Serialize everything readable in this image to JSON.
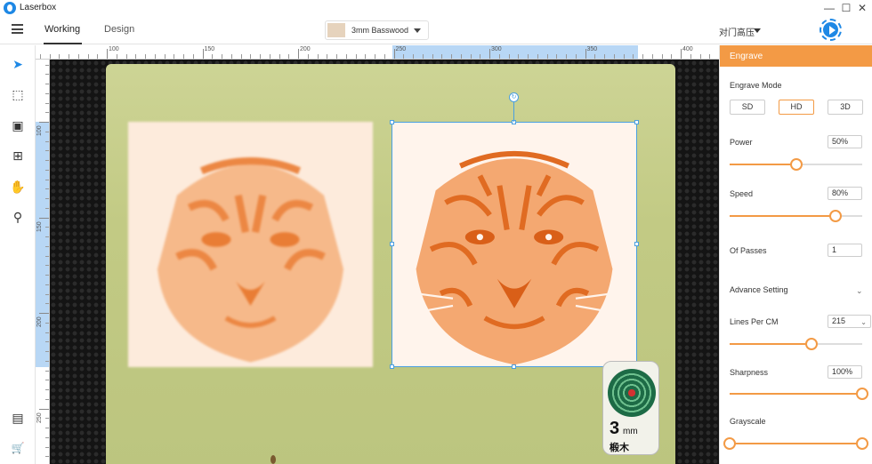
{
  "app": {
    "title": "Laserbox"
  },
  "window_controls": {
    "minimize": "—",
    "maximize": "☐",
    "close": "✕"
  },
  "header": {
    "tabs": [
      {
        "label": "Working",
        "active": true
      },
      {
        "label": "Design",
        "active": false
      }
    ],
    "material": "3mm Basswood",
    "device": "对门高压"
  },
  "tools": [
    {
      "name": "select-tool-icon",
      "glyph": "➤"
    },
    {
      "name": "node-edit-icon",
      "glyph": "⬚"
    },
    {
      "name": "image-icon",
      "glyph": "▣"
    },
    {
      "name": "shape-icon",
      "glyph": "⊞"
    },
    {
      "name": "hand-icon",
      "glyph": "✋"
    },
    {
      "name": "zoom-icon",
      "glyph": "⚲"
    },
    {
      "name": "layers-icon",
      "glyph": "▤"
    },
    {
      "name": "cart-icon",
      "glyph": "🛒"
    }
  ],
  "rulers": {
    "top_labels": [
      "100",
      "150",
      "200",
      "250",
      "300",
      "350",
      "400"
    ],
    "left_labels": [
      "100",
      "150",
      "200",
      "250"
    ]
  },
  "material_tag": {
    "thickness": "3",
    "unit": "mm",
    "name": "椴木"
  },
  "panel": {
    "title": "Engrave",
    "engrave_mode": {
      "label": "Engrave Mode",
      "options": [
        "SD",
        "HD",
        "3D"
      ],
      "selected": "HD"
    },
    "power": {
      "label": "Power",
      "value": "50%",
      "level": 0.5
    },
    "speed": {
      "label": "Speed",
      "value": "80%",
      "level": 0.8
    },
    "passes": {
      "label": "Of Passes",
      "value": "1"
    },
    "advance": {
      "label": "Advance Setting",
      "caret": "⌄"
    },
    "lines_per_cm": {
      "label": "Lines Per CM",
      "value": "215",
      "level": 0.62
    },
    "sharpness": {
      "label": "Sharpness",
      "value": "100%",
      "level": 1.0
    },
    "grayscale": {
      "label": "Grayscale",
      "min_level": 0.0,
      "max_level": 1.0
    }
  },
  "colors": {
    "accent": "#f39a45",
    "brand": "#1e88e5",
    "engrave": "#f08a3c"
  }
}
